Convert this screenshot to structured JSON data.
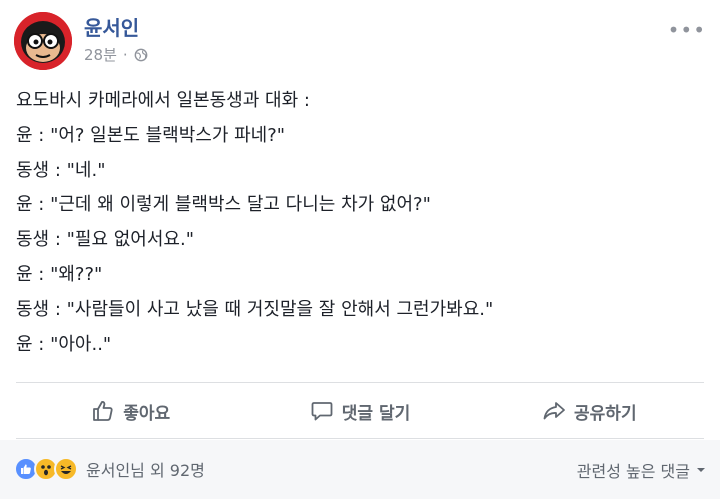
{
  "post": {
    "author": "윤서인",
    "time": "28분",
    "more_label": "•••",
    "lines": [
      "요도바시 카메라에서 일본동생과 대화 :",
      "윤 : \"어? 일본도 블랙박스가 파네?\"",
      "동생 : \"네.\"",
      "윤 : \"근데 왜 이렇게 블랙박스 달고 다니는 차가 없어?\"",
      "동생 : \"필요 없어서요.\"",
      "윤 : \"왜??\"",
      "동생 : \"사람들이 사고 났을 때 거짓말을 잘 안해서 그런가봐요.\"",
      "윤 : \"아아..\""
    ]
  },
  "actions": {
    "like": "좋아요",
    "comment": "댓글 달기",
    "share": "공유하기"
  },
  "footer": {
    "reaction_count": "윤서인님 외 92명",
    "sort_label": "관련성 높은 댓글"
  },
  "colors": {
    "author": "#365899",
    "like_blue": "#5890ff",
    "reaction_yellow": "#f7b928"
  }
}
